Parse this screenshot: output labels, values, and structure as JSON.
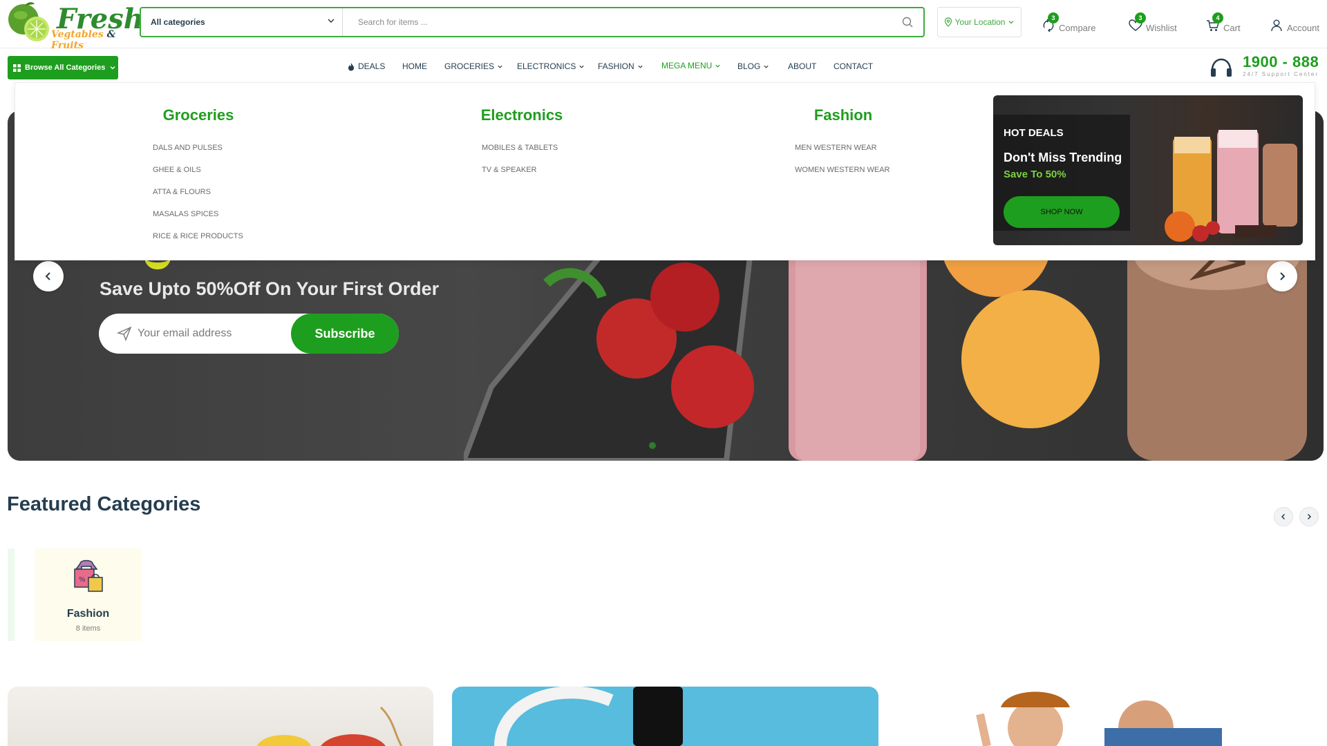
{
  "header": {
    "logo": {
      "word": "Fresh",
      "sub_veg": "Vegtables",
      "sub_amp": "&",
      "sub_fruits": "Fruits"
    },
    "category_select": "All categories",
    "search_placeholder": "Search for items ...",
    "location": "Your Location",
    "compare": {
      "label": "Compare",
      "count": "3"
    },
    "wishlist": {
      "label": "Wishlist",
      "count": "3"
    },
    "cart": {
      "label": "Cart",
      "count": "4"
    },
    "account": {
      "label": "Account"
    }
  },
  "nav": {
    "browse": "Browse All Categories",
    "items": [
      {
        "label": "DEALS",
        "icon": "fire-icon"
      },
      {
        "label": "HOME"
      },
      {
        "label": "GROCERIES",
        "dropdown": true
      },
      {
        "label": "ELECTRONICS",
        "dropdown": true
      },
      {
        "label": "FASHION",
        "dropdown": true
      },
      {
        "label": "MEGA MENU",
        "dropdown": true,
        "active": true
      },
      {
        "label": "BLOG",
        "dropdown": true
      },
      {
        "label": "ABOUT"
      },
      {
        "label": "CONTACT"
      }
    ],
    "phone": "1900 - 888",
    "support": "24/7 Support Center"
  },
  "mega_menu": {
    "columns": [
      {
        "title": "Groceries",
        "items": [
          "DALS AND PULSES",
          "GHEE & OILS",
          "ATTA & FLOURS",
          "MASALAS SPICES",
          "RICE & RICE PRODUCTS"
        ]
      },
      {
        "title": "Electronics",
        "items": [
          "MOBILES & TABLETS",
          "TV & SPEAKER"
        ]
      },
      {
        "title": "Fashion",
        "items": [
          "MEN WESTERN WEAR",
          "WOMEN WESTERN WEAR"
        ]
      }
    ],
    "promo": {
      "tag": "HOT DEALS",
      "title": "Don't Miss Trending",
      "save": "Save To 50%",
      "button": "SHOP NOW"
    }
  },
  "hero": {
    "subtitle": "Save Upto 50%Off On Your First Order",
    "email_placeholder": "Your email address",
    "subscribe": "Subscribe"
  },
  "featured": {
    "title": "Featured Categories",
    "categories": [
      {
        "name": "Fashion",
        "count": "8 items"
      }
    ]
  },
  "colors": {
    "brand_green": "#1e9e1e",
    "text_dark": "#253d4e",
    "accent_yellow": "#d7e020"
  }
}
